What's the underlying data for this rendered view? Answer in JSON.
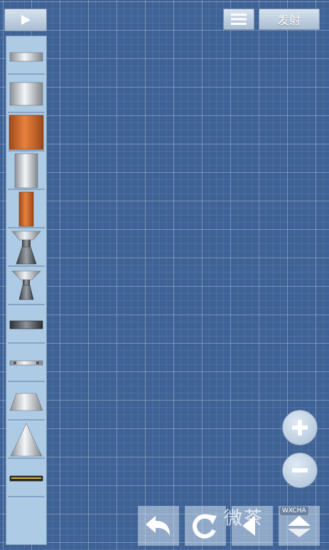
{
  "toolbar": {
    "play_icon": "play-icon",
    "menu_icon": "hamburger-menu-icon",
    "launch_label": "发射"
  },
  "palette": {
    "parts": [
      "parachute-part-icon",
      "small-fuel-tank-icon",
      "large-orange-fuel-tank-icon",
      "tall-fuel-tank-icon",
      "slim-orange-fuel-tank-icon",
      "large-engine-icon",
      "small-engine-icon",
      "separator-icon",
      "thin-separator-icon",
      "fairing-adapter-icon",
      "nose-cone-icon",
      "landing-leg-plate-icon",
      "empty-slot"
    ]
  },
  "controls": {
    "zoom_in_icon": "zoom-in-icon",
    "zoom_out_icon": "zoom-out-icon",
    "undo_icon": "undo-icon",
    "rotate_icon": "rotate-icon",
    "left_icon": "arrow-left-icon",
    "flip_icon": "flip-icon"
  },
  "watermark": {
    "text": "微茶",
    "badge": "WXCHA"
  },
  "colors": {
    "grid_background": "#3f6396",
    "palette_background": "#aecbe6",
    "button_face": "#c7d6e6",
    "orange_tank": "#d56a2a"
  }
}
